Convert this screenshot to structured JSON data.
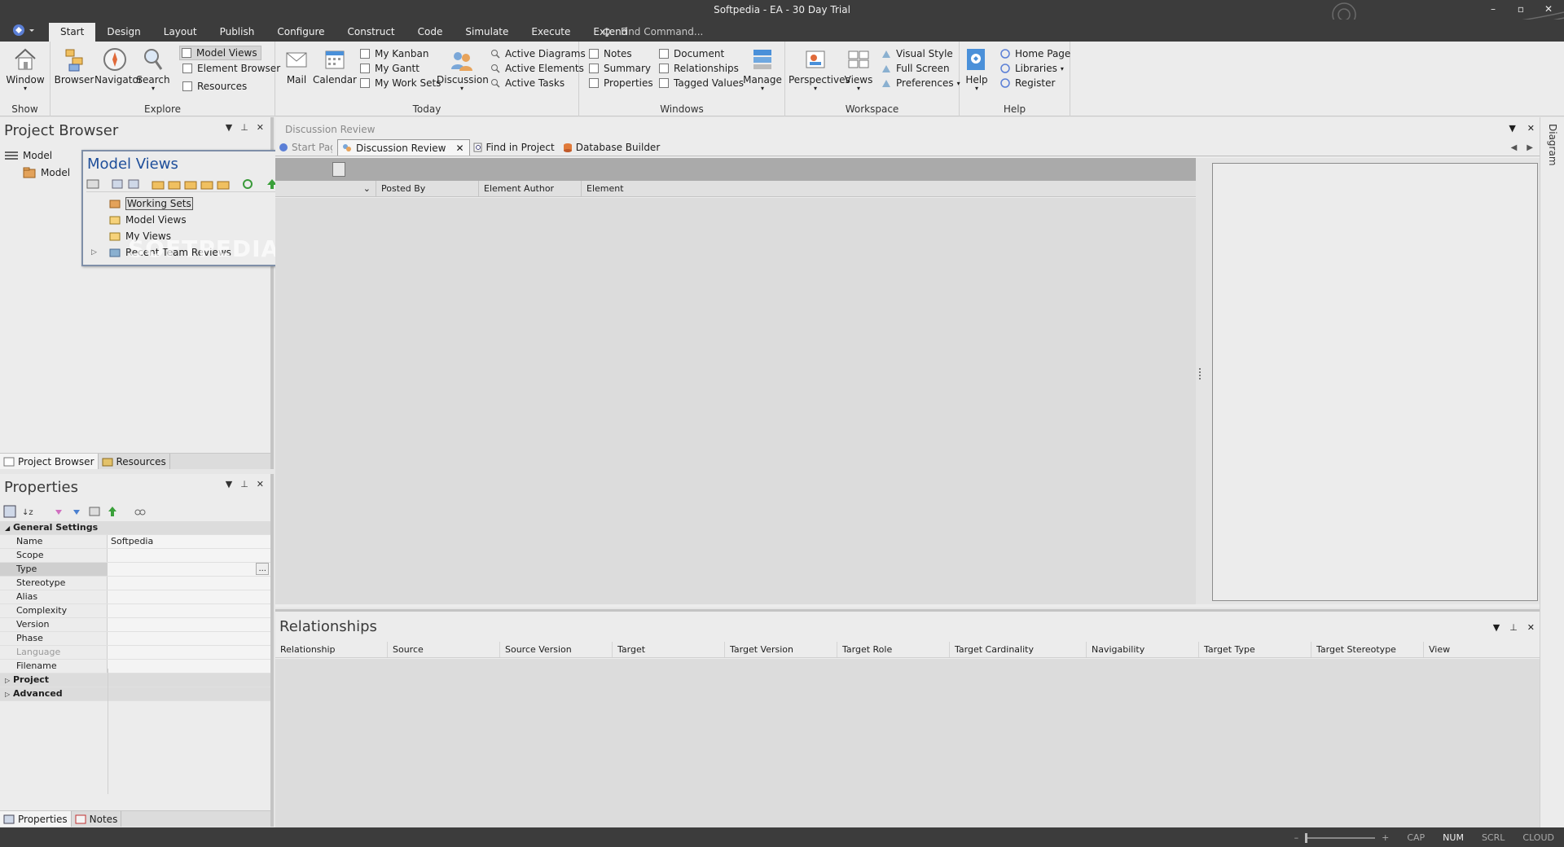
{
  "window": {
    "title": "Softpedia - EA - 30 Day Trial",
    "controls": [
      "–",
      "▫",
      "✕"
    ]
  },
  "menubar": {
    "tabs": [
      "Start",
      "Design",
      "Layout",
      "Publish",
      "Configure",
      "Construct",
      "Code",
      "Simulate",
      "Execute",
      "Extend"
    ],
    "active_tab": "Start",
    "find_command": "Find Command..."
  },
  "ribbon": {
    "show": {
      "label": "Show",
      "window": "Window"
    },
    "explore": {
      "label": "Explore",
      "browser": "Browser",
      "navigator": "Navigator",
      "search": "Search",
      "model_views": "Model Views",
      "element_browser": "Element Browser",
      "resources": "Resources"
    },
    "today": {
      "label": "Today",
      "mail": "Mail",
      "calendar": "Calendar",
      "my_kanban": "My Kanban",
      "my_gantt": "My Gantt",
      "my_work_sets": "My Work Sets",
      "discussion": "Discussion",
      "active_diagrams": "Active Diagrams",
      "active_elements": "Active Elements",
      "active_tasks": "Active Tasks"
    },
    "windows": {
      "label": "Windows",
      "notes": "Notes",
      "summary": "Summary",
      "properties": "Properties",
      "document": "Document",
      "relationships": "Relationships",
      "tagged_values": "Tagged Values",
      "manage": "Manage"
    },
    "workspace": {
      "label": "Workspace",
      "perspectives": "Perspectives",
      "views": "Views",
      "visual_style": "Visual Style",
      "full_screen": "Full Screen",
      "preferences": "Preferences"
    },
    "help": {
      "label": "Help",
      "help": "Help",
      "home_page": "Home Page",
      "libraries": "Libraries",
      "register": "Register"
    }
  },
  "project_browser": {
    "title": "Project Browser",
    "tree": [
      "Model",
      "Model"
    ],
    "bottom_tabs": [
      "Project Browser",
      "Resources"
    ]
  },
  "model_views": {
    "title": "Model Views",
    "items": [
      "Working Sets",
      "Model Views",
      "My Views",
      "Recent Team Reviews"
    ],
    "watermark": "SOFTPEDIA"
  },
  "properties": {
    "title": "Properties",
    "general_settings": "General Settings",
    "rows": [
      {
        "key": "Name",
        "value": "Softpedia"
      },
      {
        "key": "Scope",
        "value": ""
      },
      {
        "key": "Type",
        "value": ""
      },
      {
        "key": "Stereotype",
        "value": ""
      },
      {
        "key": "Alias",
        "value": ""
      },
      {
        "key": "Complexity",
        "value": ""
      },
      {
        "key": "Version",
        "value": ""
      },
      {
        "key": "Phase",
        "value": ""
      },
      {
        "key": "Language",
        "value": ""
      },
      {
        "key": "Filename",
        "value": ""
      }
    ],
    "type_ellipsis": "...",
    "sections": [
      "Project",
      "Advanced"
    ],
    "bottom_tabs": [
      "Properties",
      "Notes"
    ]
  },
  "doc": {
    "breadcrumb": "Discussion Review",
    "tabs": [
      "Start Page",
      "Discussion Review",
      "Find in Project",
      "Database Builder"
    ],
    "active_tab": "Discussion Review",
    "columns": [
      "Posted By",
      "Element Author",
      "Element"
    ]
  },
  "relationships": {
    "title": "Relationships",
    "columns": [
      "Relationship",
      "Source",
      "Source Version",
      "Target",
      "Target Version",
      "Target Role",
      "Target Cardinality",
      "Navigability",
      "Target Type",
      "Target Stereotype",
      "View"
    ]
  },
  "right_tab": "Diagram",
  "statusbar": {
    "zoom_minus": "–",
    "zoom_plus": "+",
    "cap": "CAP",
    "num": "NUM",
    "scrl": "SCRL",
    "cloud": "CLOUD"
  }
}
